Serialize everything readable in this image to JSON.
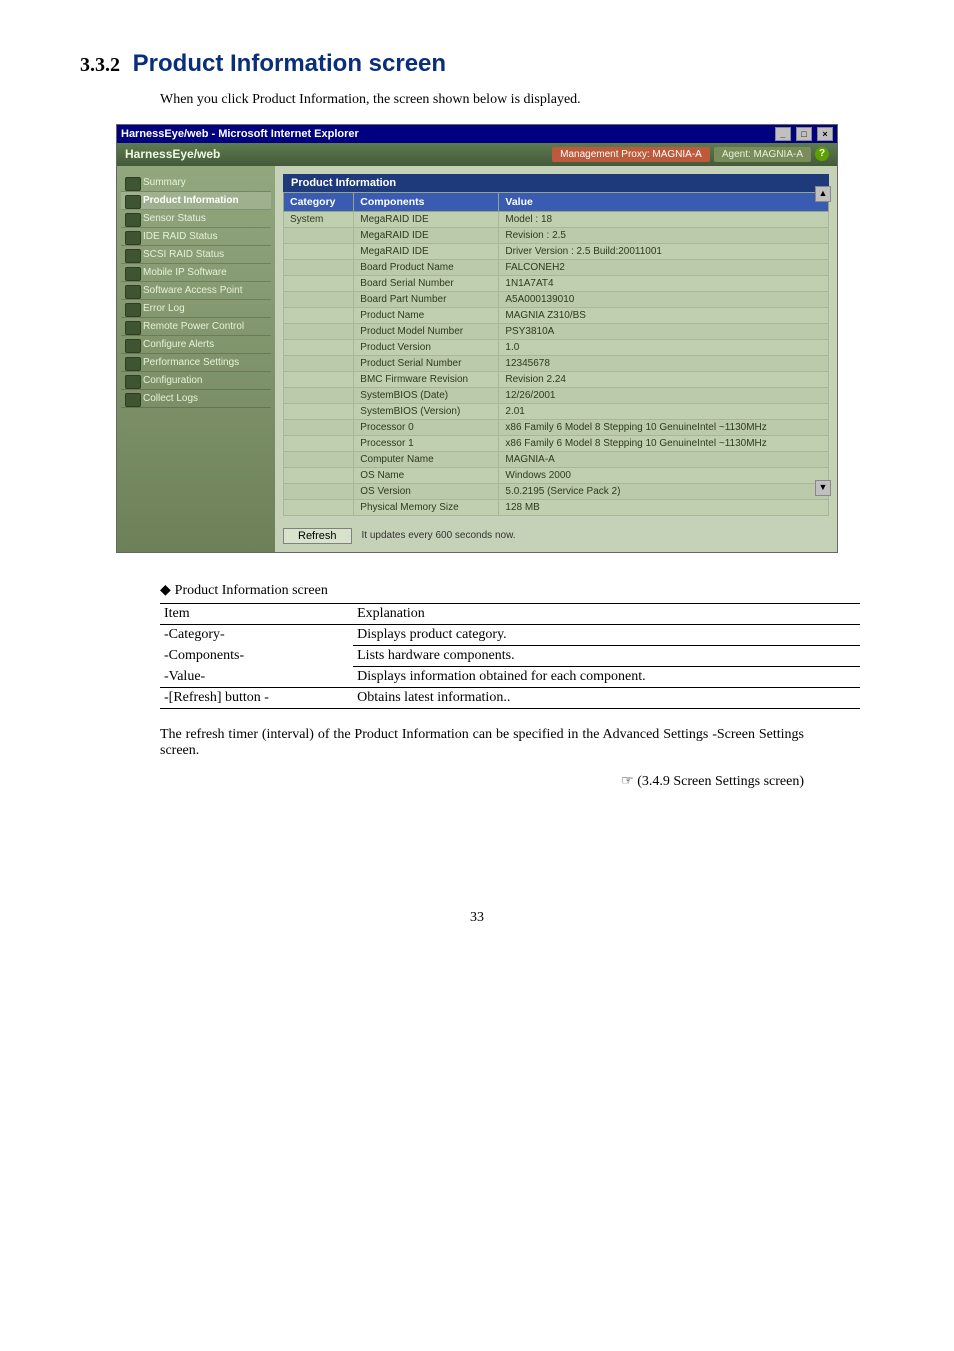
{
  "document": {
    "section_number": "3.3.2",
    "section_title": "Product Information screen",
    "intro_text": "When you click Product Information, the screen shown below is displayed.",
    "caption": "Product Information screen",
    "paragraph": "The refresh timer (interval) of the Product Information can be specified in the Advanced Settings -Screen Settings screen.",
    "crossref": "(3.4.9 Screen Settings screen)",
    "page_number": "33"
  },
  "explain_table": {
    "headers": [
      "Item",
      "Explanation"
    ],
    "rows": [
      {
        "item": "-Category-",
        "explanation": "Displays product category."
      },
      {
        "item": "-Components-",
        "explanation": "Lists hardware components."
      },
      {
        "item": "-Value-",
        "explanation": "Displays information obtained for each component."
      },
      {
        "item": "-[Refresh] button -",
        "explanation": "Obtains latest information.."
      }
    ]
  },
  "screenshot": {
    "window_title": "HarnessEye/web - Microsoft Internet Explorer",
    "app_title": "HarnessEye/web",
    "proxy_label": "Management Proxy: MAGNIA-A",
    "agent_label": "Agent: MAGNIA-A",
    "help_icon": "?",
    "sidebar_items": [
      "Summary",
      "Product Information",
      "Sensor Status",
      "IDE RAID Status",
      "SCSI RAID Status",
      "Mobile IP Software",
      "Software Access Point",
      "Error Log",
      "Remote Power Control",
      "Configure Alerts",
      "Performance Settings",
      "Configuration",
      "Collect Logs"
    ],
    "panel_title": "Product Information",
    "grid_headers": [
      "Category",
      "Components",
      "Value"
    ],
    "grid_rows": [
      {
        "category": "System",
        "component": "MegaRAID IDE",
        "value": "Model : 18"
      },
      {
        "category": "",
        "component": "MegaRAID IDE",
        "value": "Revision : 2.5"
      },
      {
        "category": "",
        "component": "MegaRAID IDE",
        "value": "Driver Version : 2.5 Build:20011001"
      },
      {
        "category": "",
        "component": "Board Product Name",
        "value": "FALCONEH2"
      },
      {
        "category": "",
        "component": "Board Serial Number",
        "value": "1N1A7AT4"
      },
      {
        "category": "",
        "component": "Board Part Number",
        "value": "A5A000139010"
      },
      {
        "category": "",
        "component": "Product Name",
        "value": "MAGNIA Z310/BS"
      },
      {
        "category": "",
        "component": "Product Model Number",
        "value": "PSY3810A"
      },
      {
        "category": "",
        "component": "Product Version",
        "value": "1.0"
      },
      {
        "category": "",
        "component": "Product Serial Number",
        "value": "12345678"
      },
      {
        "category": "",
        "component": "BMC Firmware Revision",
        "value": "Revision 2.24"
      },
      {
        "category": "",
        "component": "SystemBIOS (Date)",
        "value": "12/26/2001"
      },
      {
        "category": "",
        "component": "SystemBIOS (Version)",
        "value": "2.01"
      },
      {
        "category": "",
        "component": "Processor 0",
        "value": "x86 Family 6 Model 8 Stepping 10 GenuineIntel ~1130MHz"
      },
      {
        "category": "",
        "component": "Processor 1",
        "value": "x86 Family 6 Model 8 Stepping 10 GenuineIntel ~1130MHz"
      },
      {
        "category": "",
        "component": "Computer Name",
        "value": "MAGNIA-A"
      },
      {
        "category": "",
        "component": "OS Name",
        "value": "Windows 2000"
      },
      {
        "category": "",
        "component": "OS Version",
        "value": "5.0.2195 (Service Pack 2)"
      },
      {
        "category": "",
        "component": "Physical Memory Size",
        "value": "128 MB"
      }
    ],
    "refresh_button": "Refresh",
    "refresh_text": "It updates every 600 seconds now."
  }
}
